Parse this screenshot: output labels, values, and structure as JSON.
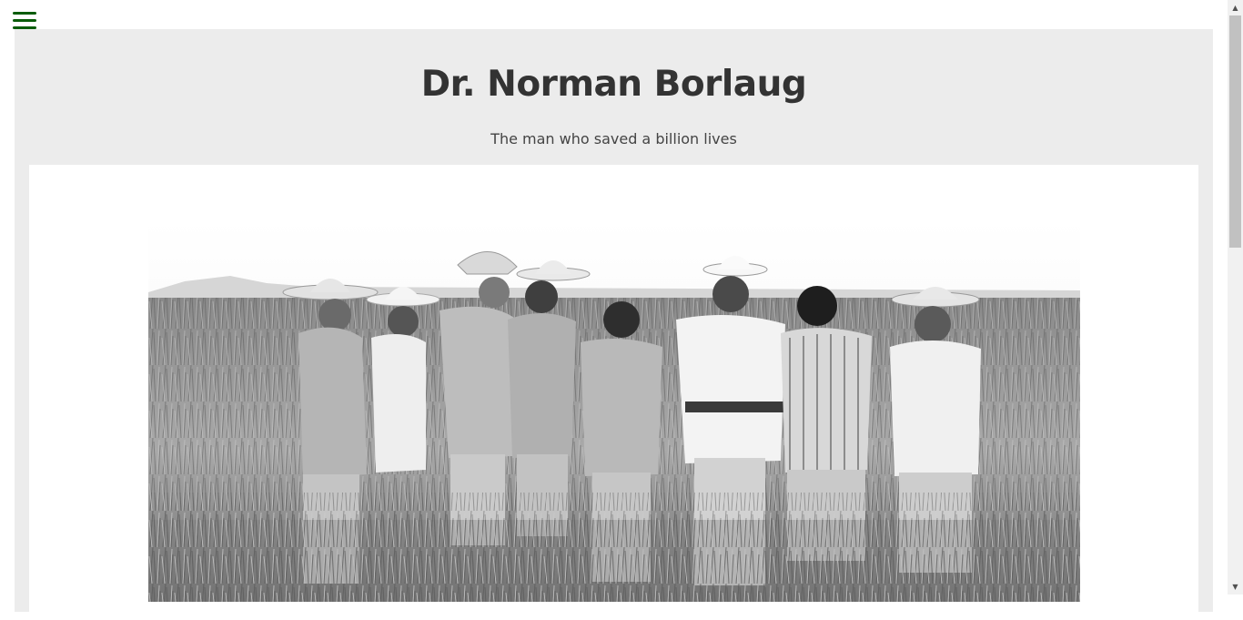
{
  "nav": {
    "menu_icon": "hamburger-menu-icon",
    "menu_color": "#0a5c0a"
  },
  "header": {
    "title": "Dr. Norman Borlaug",
    "subtitle": "The man who saved a billion lives"
  },
  "image": {
    "alt": "",
    "style": "black-and-white photograph of men in a wheat field"
  },
  "scrollbar": {
    "up_icon": "▲",
    "down_icon": "▼"
  }
}
